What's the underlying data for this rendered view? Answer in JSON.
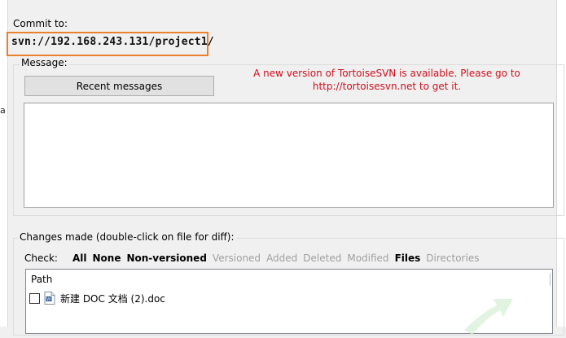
{
  "commit": {
    "label": "Commit to:",
    "url": "svn://192.168.243.131/project1/"
  },
  "message": {
    "legend": "Message:",
    "recent_button": "Recent messages",
    "notice_line1": "A new version of TortoiseSVN is available. Please go to",
    "notice_line2": "http://tortoisesvn.net to get it.",
    "text": ""
  },
  "changes": {
    "legend": "Changes made (double-click on file for diff):",
    "check_label": "Check:",
    "filters": [
      {
        "label": "All",
        "enabled": true
      },
      {
        "label": "None",
        "enabled": true
      },
      {
        "label": "Non-versioned",
        "enabled": true
      },
      {
        "label": "Versioned",
        "enabled": false
      },
      {
        "label": "Added",
        "enabled": false
      },
      {
        "label": "Deleted",
        "enabled": false
      },
      {
        "label": "Modified",
        "enabled": false
      },
      {
        "label": "Files",
        "enabled": true
      },
      {
        "label": "Directories",
        "enabled": false
      }
    ],
    "columns": [
      "Path"
    ],
    "files": [
      {
        "name": "新建 DOC 文档 (2).doc",
        "checked": false,
        "icon": "word-doc-icon"
      }
    ]
  },
  "colors": {
    "highlight_border": "#e8822f",
    "notice": "#d0101e",
    "disabled_filter": "#a0a0a0"
  }
}
